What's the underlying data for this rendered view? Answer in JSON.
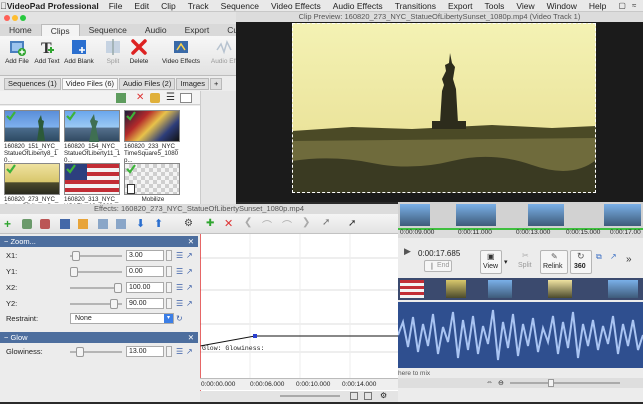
{
  "menubar": {
    "app_name": "VideoPad Professional",
    "items": [
      "File",
      "Edit",
      "Clip",
      "Track",
      "Sequence",
      "Video Effects",
      "Audio Effects",
      "Transitions",
      "Export",
      "Tools",
      "View",
      "Window",
      "Help"
    ],
    "right_text": "Th"
  },
  "app_tabs": [
    "Home",
    "Clips",
    "Sequence",
    "Audio",
    "Export",
    "Custom"
  ],
  "active_tab": "Clips",
  "toolbar": {
    "add_file": "Add File",
    "add_text": "Add Text",
    "add_blank": "Add Blank",
    "split": "Split",
    "delete": "Delete",
    "video_effects": "Video Effects",
    "audio_effects": "Audio Eff"
  },
  "media_tabs": [
    "Sequences (1)",
    "Video Files (6)",
    "Audio Files (2)",
    "Images",
    "+"
  ],
  "active_media_tab": "Video Files (6)",
  "clips": [
    {
      "label": "160820_151_NYC_StatueOfLiberty8_10...",
      "checked": true
    },
    {
      "label": "160820_154_NYC_StatueOfLiberty11_10...",
      "checked": true
    },
    {
      "label": "160820_233_NYC_TimeSquare5_1080p...",
      "checked": true
    },
    {
      "label": "160820_273_NYC_StatueOfLibertySuns...",
      "checked": true
    },
    {
      "label": "160820_313_NYC_USAFlag19_1080p.mp4",
      "checked": true
    },
    {
      "label": "Mobilize",
      "checked": true
    }
  ],
  "preview": {
    "title": "Clip Preview: 160820_273_NYC_StatueOfLibertySunset_1080p.mp4 (Video Track 1)"
  },
  "effects": {
    "title": "Effects: 160820_273_NYC_StatueOfLibertySunset_1080p.mp4",
    "zoom_section": "Zoom...",
    "x1_label": "X1:",
    "x1_value": "3.00",
    "y1_label": "Y1:",
    "y1_value": "0.00",
    "x2_label": "X2:",
    "x2_value": "100.00",
    "y2_label": "Y2:",
    "y2_value": "90.00",
    "restraint_label": "Restraint:",
    "restraint_value": "None",
    "glow_section": "Glow",
    "glowiness_label": "Glowiness:",
    "glowiness_value": "13.00",
    "graph_label": "Glow: Glowiness:",
    "graph_times": [
      "0:00:00.000",
      "0:00:06.000",
      "0:00:10.000",
      "0:00:14.000"
    ]
  },
  "timeline": {
    "ruler": [
      "0:00:09.000",
      "0:00:11.000",
      "0:00:13.000",
      "0:00:15.000",
      "0:00:17.00"
    ],
    "timecode": "0:00:17.685",
    "end_label": "End",
    "view_label": "View",
    "split_label": "Split",
    "relink_label": "Relink",
    "rotate_label": "360",
    "hint_text": "here to mix"
  },
  "colors": {
    "section_blue": "#4d6e9e",
    "check_green": "#3db33a",
    "timeline_green": "#3fbf3f"
  }
}
